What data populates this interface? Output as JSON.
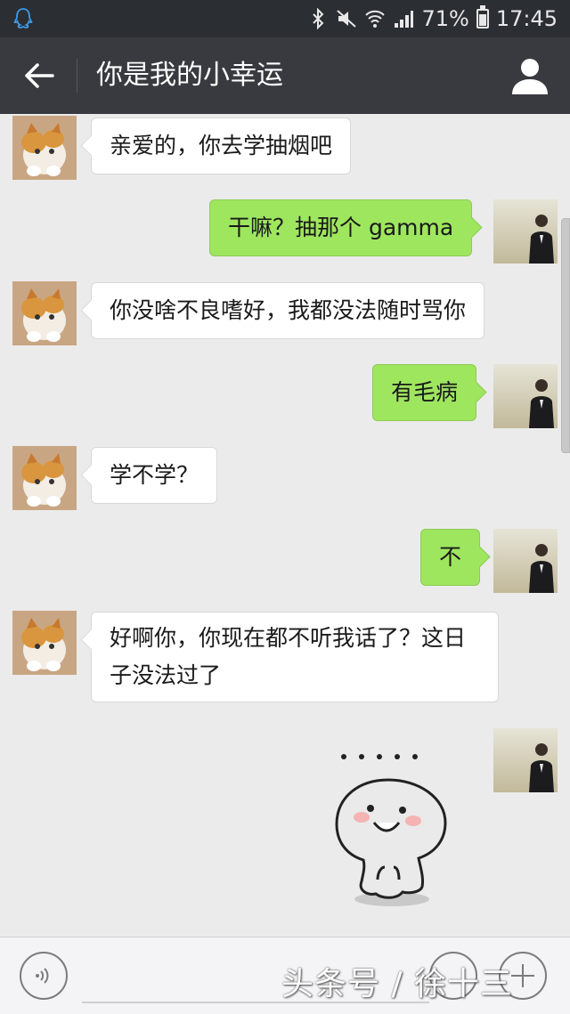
{
  "status_bar": {
    "battery": "71%",
    "time": "17:45"
  },
  "header": {
    "title": "你是我的小幸运"
  },
  "messages": [
    {
      "side": "left",
      "text": "亲爱的，你去学抽烟吧"
    },
    {
      "side": "right",
      "text": "干嘛？抽那个 gamma"
    },
    {
      "side": "left",
      "text": "你没啥不良嗜好，我都没法随时骂你"
    },
    {
      "side": "right",
      "text": "有毛病"
    },
    {
      "side": "left",
      "text": "学不学？"
    },
    {
      "side": "right",
      "text": "不"
    },
    {
      "side": "left",
      "text": "好啊你，你现在都不听我话了？这日子没法过了"
    },
    {
      "side": "right",
      "sticker": "ellipsis-dots-blob-sticker"
    }
  ],
  "watermark": "头条号 / 徐十三",
  "icons": {
    "status": [
      "qq-icon",
      "bluetooth-icon",
      "mute-icon",
      "wifi-icon",
      "signal-icon",
      "battery-icon"
    ],
    "header": [
      "back-arrow-icon",
      "profile-icon"
    ],
    "input": [
      "voice-icon",
      "emoji-icon",
      "plus-icon"
    ]
  },
  "colors": {
    "sent_bubble": "#9fe65f",
    "received_bubble": "#ffffff",
    "title_bar": "#393a3f",
    "status_bar": "#2b2e33",
    "chat_background": "#ebebeb"
  }
}
